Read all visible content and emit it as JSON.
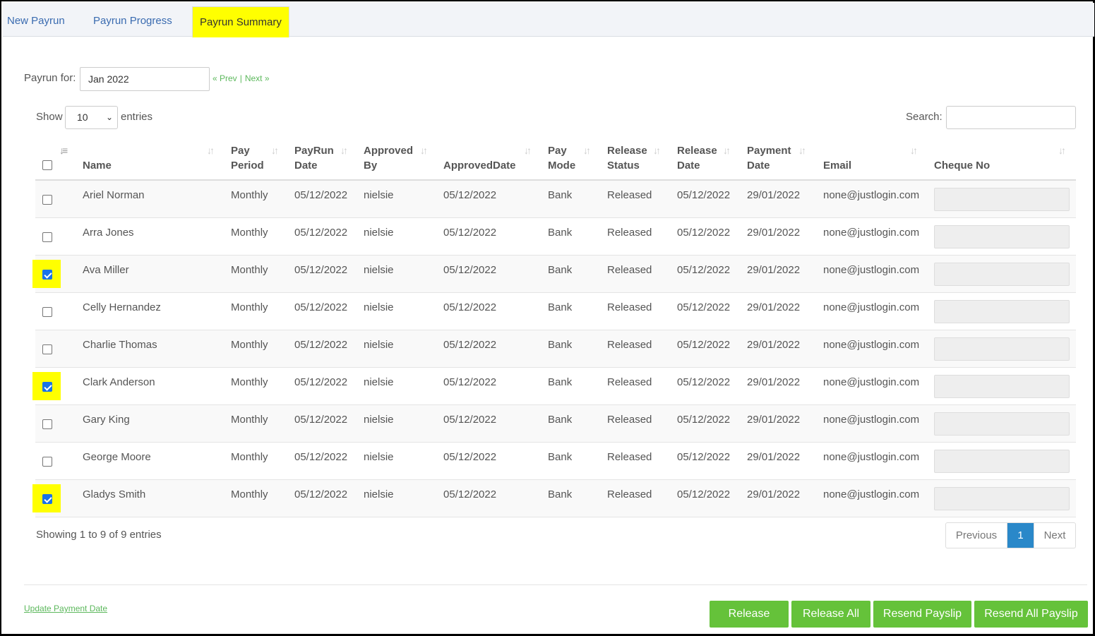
{
  "tabs": [
    {
      "label": "New Payrun"
    },
    {
      "label": "Payrun Progress"
    },
    {
      "label": "Payrun Summary",
      "active": true
    }
  ],
  "payrun": {
    "label": "Payrun for:",
    "value": "Jan 2022",
    "prev": "« Prev",
    "separator": "|",
    "next": "Next »"
  },
  "table_controls": {
    "show_label": "Show",
    "entries_value": "10",
    "entries_label": "entries",
    "search_label": "Search:"
  },
  "columns": [
    {
      "l1": "",
      "l2": "Name"
    },
    {
      "l1": "Pay",
      "l2": "Period"
    },
    {
      "l1": "PayRun",
      "l2": "Date"
    },
    {
      "l1": "Approved",
      "l2": "By"
    },
    {
      "l1": "",
      "l2": "ApprovedDate"
    },
    {
      "l1": "Pay",
      "l2": "Mode"
    },
    {
      "l1": "Release",
      "l2": "Status"
    },
    {
      "l1": "Release",
      "l2": "Date"
    },
    {
      "l1": "Payment",
      "l2": "Date"
    },
    {
      "l1": "",
      "l2": "Email"
    },
    {
      "l1": "",
      "l2": "Cheque No"
    }
  ],
  "rows": [
    {
      "checked": false,
      "name": "Ariel Norman",
      "period": "Monthly",
      "payrun_date": "05/12/2022",
      "approved_by": "nielsie",
      "approved_date": "05/12/2022",
      "mode": "Bank",
      "status": "Released",
      "release_date": "05/12/2022",
      "payment_date": "29/01/2022",
      "email": "none@justlogin.com"
    },
    {
      "checked": false,
      "name": "Arra Jones",
      "period": "Monthly",
      "payrun_date": "05/12/2022",
      "approved_by": "nielsie",
      "approved_date": "05/12/2022",
      "mode": "Bank",
      "status": "Released",
      "release_date": "05/12/2022",
      "payment_date": "29/01/2022",
      "email": "none@justlogin.com"
    },
    {
      "checked": true,
      "name": "Ava Miller",
      "period": "Monthly",
      "payrun_date": "05/12/2022",
      "approved_by": "nielsie",
      "approved_date": "05/12/2022",
      "mode": "Bank",
      "status": "Released",
      "release_date": "05/12/2022",
      "payment_date": "29/01/2022",
      "email": "none@justlogin.com"
    },
    {
      "checked": false,
      "name": "Celly Hernandez",
      "period": "Monthly",
      "payrun_date": "05/12/2022",
      "approved_by": "nielsie",
      "approved_date": "05/12/2022",
      "mode": "Bank",
      "status": "Released",
      "release_date": "05/12/2022",
      "payment_date": "29/01/2022",
      "email": "none@justlogin.com"
    },
    {
      "checked": false,
      "name": "Charlie Thomas",
      "period": "Monthly",
      "payrun_date": "05/12/2022",
      "approved_by": "nielsie",
      "approved_date": "05/12/2022",
      "mode": "Bank",
      "status": "Released",
      "release_date": "05/12/2022",
      "payment_date": "29/01/2022",
      "email": "none@justlogin.com"
    },
    {
      "checked": true,
      "name": "Clark Anderson",
      "period": "Monthly",
      "payrun_date": "05/12/2022",
      "approved_by": "nielsie",
      "approved_date": "05/12/2022",
      "mode": "Bank",
      "status": "Released",
      "release_date": "05/12/2022",
      "payment_date": "29/01/2022",
      "email": "none@justlogin.com"
    },
    {
      "checked": false,
      "name": "Gary King",
      "period": "Monthly",
      "payrun_date": "05/12/2022",
      "approved_by": "nielsie",
      "approved_date": "05/12/2022",
      "mode": "Bank",
      "status": "Released",
      "release_date": "05/12/2022",
      "payment_date": "29/01/2022",
      "email": "none@justlogin.com"
    },
    {
      "checked": false,
      "name": "George Moore",
      "period": "Monthly",
      "payrun_date": "05/12/2022",
      "approved_by": "nielsie",
      "approved_date": "05/12/2022",
      "mode": "Bank",
      "status": "Released",
      "release_date": "05/12/2022",
      "payment_date": "29/01/2022",
      "email": "none@justlogin.com"
    },
    {
      "checked": true,
      "name": "Gladys Smith",
      "period": "Monthly",
      "payrun_date": "05/12/2022",
      "approved_by": "nielsie",
      "approved_date": "05/12/2022",
      "mode": "Bank",
      "status": "Released",
      "release_date": "05/12/2022",
      "payment_date": "29/01/2022",
      "email": "none@justlogin.com"
    }
  ],
  "footer": {
    "showing": "Showing 1 to 9 of 9 entries",
    "prev": "Previous",
    "page": "1",
    "next": "Next"
  },
  "actions": {
    "update_link": "Update Payment Date",
    "release": "Release",
    "release_all": "Release All",
    "resend_payslip": "Resend Payslip",
    "resend_all": "Resend All Payslip"
  },
  "colors": {
    "highlight": "#ffff00",
    "accent_green": "#65c23a",
    "link_green": "#5cb85c",
    "page_blue": "#2a88c9",
    "tab_blue": "#3a6bb0"
  }
}
